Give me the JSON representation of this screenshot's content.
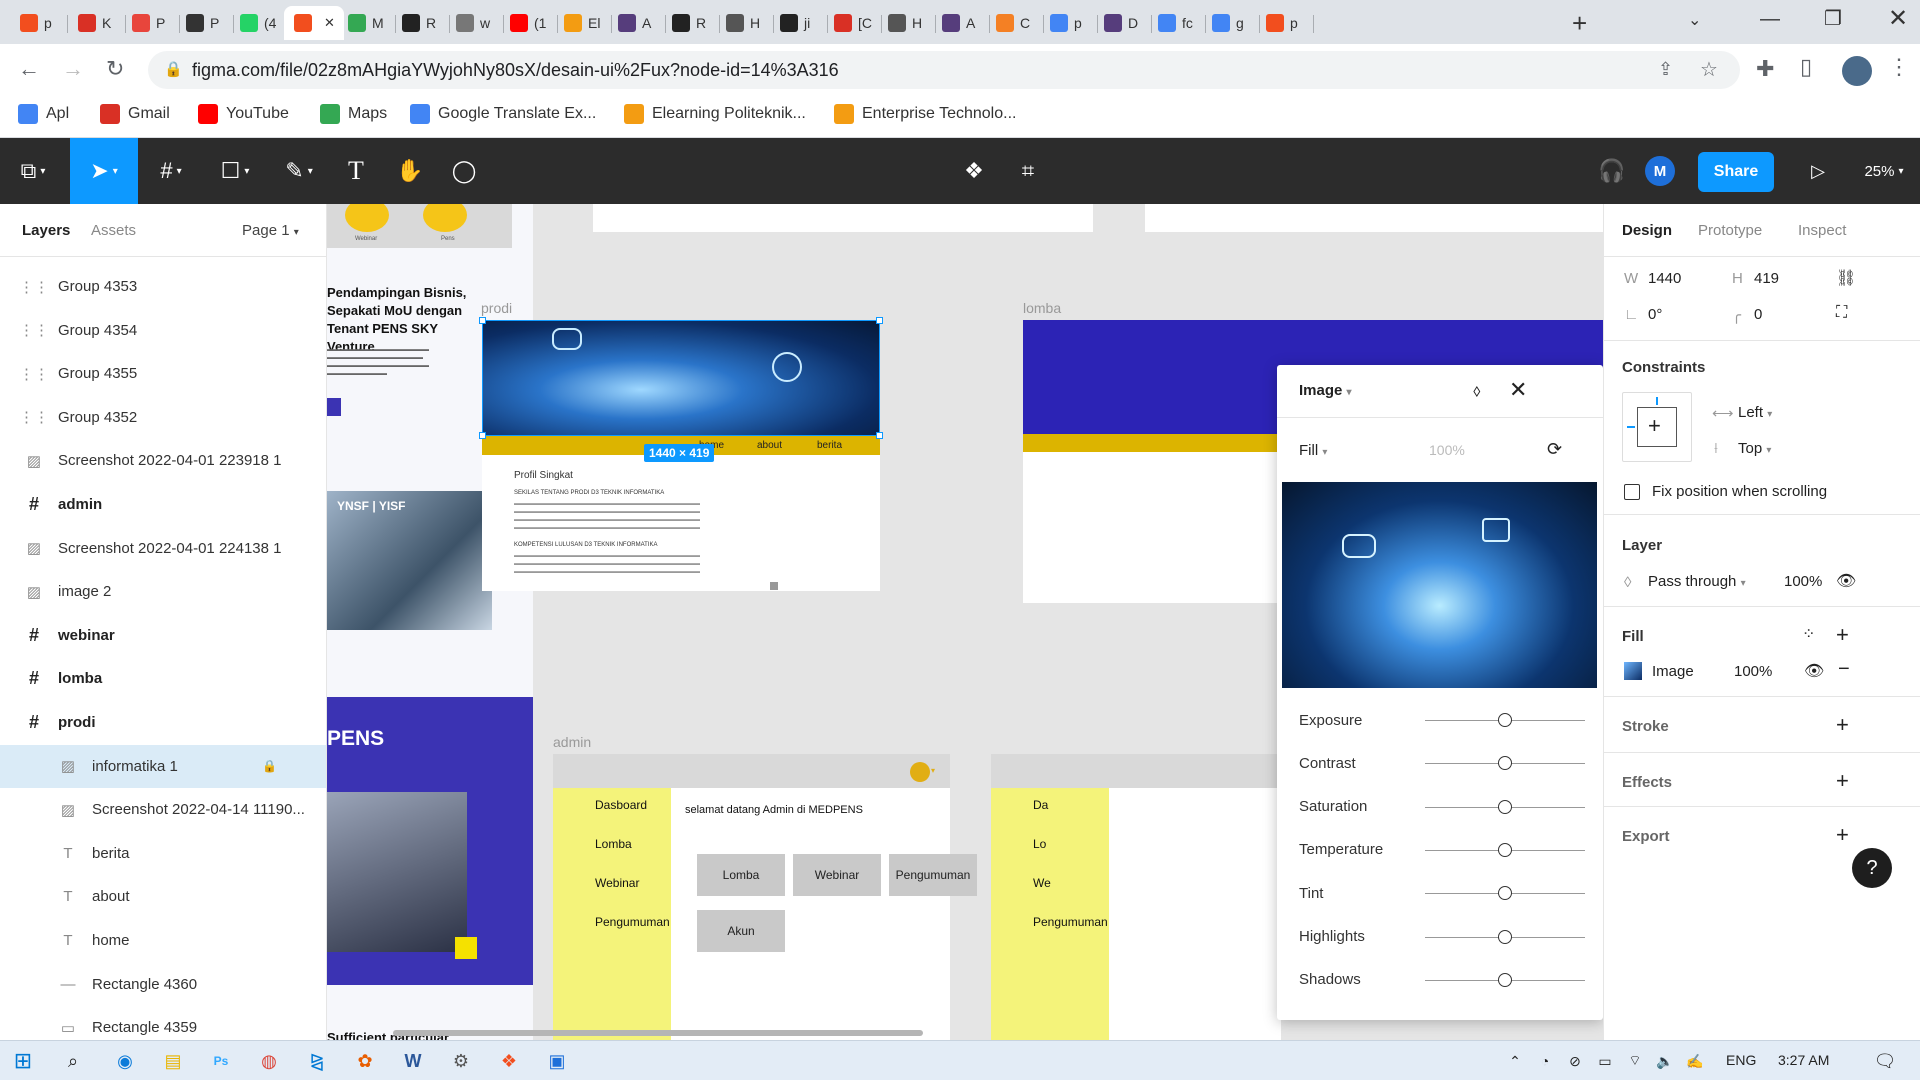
{
  "browser": {
    "tabs": [
      {
        "label": "p",
        "favicon": "figma",
        "color": "#f24e1e"
      },
      {
        "label": "K",
        "favicon": "gmail",
        "color": "#d93025"
      },
      {
        "label": "P",
        "favicon": "office-grid",
        "color": "#e8453c"
      },
      {
        "label": "P",
        "favicon": "ms",
        "color": "#333333"
      },
      {
        "label": "(4",
        "favicon": "whatsapp-49",
        "color": "#25d366"
      },
      {
        "label": "",
        "favicon": "figma",
        "color": "#f24e1e",
        "active": true
      },
      {
        "label": "M",
        "favicon": "sheets",
        "color": "#34a853"
      },
      {
        "label": "R",
        "favicon": "github",
        "color": "#222222"
      },
      {
        "label": "w",
        "favicon": "globe",
        "color": "#777777"
      },
      {
        "label": "(1",
        "favicon": "youtube",
        "color": "#ff0000"
      },
      {
        "label": "El",
        "favicon": "elearning",
        "color": "#f39c12"
      },
      {
        "label": "A",
        "favicon": "bootstrap",
        "color": "#563d7c"
      },
      {
        "label": "R",
        "favicon": "github",
        "color": "#222222"
      },
      {
        "label": "H",
        "favicon": "globe",
        "color": "#555555"
      },
      {
        "label": "ji",
        "favicon": "github",
        "color": "#222222"
      },
      {
        "label": "[C",
        "favicon": "gmail",
        "color": "#d93025"
      },
      {
        "label": "H",
        "favicon": "globe",
        "color": "#555555"
      },
      {
        "label": "A",
        "favicon": "bootstrap",
        "color": "#563d7c"
      },
      {
        "label": "C",
        "favicon": "stackoverflow",
        "color": "#f48024"
      },
      {
        "label": "p",
        "favicon": "google",
        "color": "#4285f4"
      },
      {
        "label": "D",
        "favicon": "bootstrap",
        "color": "#563d7c"
      },
      {
        "label": "fc",
        "favicon": "google",
        "color": "#4285f4"
      },
      {
        "label": "g",
        "favicon": "google",
        "color": "#4285f4"
      },
      {
        "label": "p",
        "favicon": "figma",
        "color": "#f24e1e"
      }
    ],
    "url": "figma.com/file/02z8mAHgiaYWyjohNy80sX/desain-ui%2Fux?node-id=14%3A316",
    "bookmarks": [
      {
        "label": "Apl",
        "icon": "apps-grid-icon",
        "color": "#4285f4"
      },
      {
        "label": "Gmail",
        "icon": "gmail-icon",
        "color": "#d93025"
      },
      {
        "label": "YouTube",
        "icon": "youtube-icon",
        "color": "#ff0000"
      },
      {
        "label": "Maps",
        "icon": "maps-icon",
        "color": "#34a853"
      },
      {
        "label": "Google Translate Ex...",
        "icon": "translate-icon",
        "color": "#4285f4"
      },
      {
        "label": "Elearning Politeknik...",
        "icon": "elearning-icon",
        "color": "#f39c12"
      },
      {
        "label": "Enterprise Technolo...",
        "icon": "enterprise-icon",
        "color": "#f39c12"
      }
    ]
  },
  "toolbar": {
    "share_label": "Share",
    "avatar_letter": "M",
    "zoom": "25%",
    "accent": "#0d99ff"
  },
  "left_panel": {
    "tab_layers": "Layers",
    "tab_assets": "Assets",
    "page": "Page 1",
    "layers": [
      {
        "name": "Group 4353",
        "icon": "group",
        "indent": 0
      },
      {
        "name": "Group 4354",
        "icon": "group",
        "indent": 0
      },
      {
        "name": "Group 4355",
        "icon": "group",
        "indent": 0
      },
      {
        "name": "Group 4352",
        "icon": "group",
        "indent": 0
      },
      {
        "name": "Screenshot 2022-04-01 223918 1",
        "icon": "image",
        "indent": 0
      },
      {
        "name": "admin",
        "icon": "frame",
        "indent": 0,
        "bold": true
      },
      {
        "name": "Screenshot 2022-04-01 224138 1",
        "icon": "image",
        "indent": 0
      },
      {
        "name": "image 2",
        "icon": "image",
        "indent": 0
      },
      {
        "name": "webinar",
        "icon": "frame",
        "indent": 0,
        "bold": true
      },
      {
        "name": "lomba",
        "icon": "frame",
        "indent": 0,
        "bold": true
      },
      {
        "name": "prodi",
        "icon": "frame",
        "indent": 0,
        "bold": true
      },
      {
        "name": "informatika 1",
        "icon": "image",
        "indent": 1,
        "selected": true,
        "locked": true
      },
      {
        "name": "Screenshot 2022-04-14 11190...",
        "icon": "image",
        "indent": 1
      },
      {
        "name": "berita",
        "icon": "text",
        "indent": 1
      },
      {
        "name": "about",
        "icon": "text",
        "indent": 1
      },
      {
        "name": "home",
        "icon": "text",
        "indent": 1
      },
      {
        "name": "Rectangle 4360",
        "icon": "line",
        "indent": 1
      },
      {
        "name": "Rectangle 4359",
        "icon": "rect",
        "indent": 1
      }
    ]
  },
  "canvas": {
    "frame_prodi": "prodi",
    "frame_lomba": "lomba",
    "frame_admin": "admin",
    "size_badge": "1440 × 419",
    "prodi_nav": [
      "home",
      "about",
      "berita"
    ],
    "profil_title": "Profil Singkat",
    "profil_h1": "SEKILAS TENTANG PRODI D3 TEKNIK INFORMATIKA",
    "profil_h2": "KOMPETENSI LULUSAN D3 TEKNIK INFORMATIKA",
    "side_title": "Pendampingan Bisnis, Sepakati MoU dengan Tenant PENS SKY Venture",
    "side_webinar": "Webinar",
    "side_pens": "Pens",
    "side_pens_big": "PENS",
    "side_bottom": "Sufficient particular",
    "admin_menu": [
      "Dasboard",
      "Lomba",
      "Webinar",
      "Pengumuman"
    ],
    "admin_menu_right": [
      "Da",
      "Lo",
      "We",
      "Pengumuman"
    ],
    "admin_welcome": "selamat datang Admin di MEDPENS",
    "admin_buttons": [
      "Lomba",
      "Webinar",
      "Pengumuman",
      "Akun"
    ]
  },
  "image_popup": {
    "title": "Image",
    "fill_mode": "Fill",
    "opacity": "100%",
    "sliders": [
      {
        "label": "Exposure",
        "value": 0
      },
      {
        "label": "Contrast",
        "value": 0
      },
      {
        "label": "Saturation",
        "value": 0
      },
      {
        "label": "Temperature",
        "value": 0
      },
      {
        "label": "Tint",
        "value": 0
      },
      {
        "label": "Highlights",
        "value": 0
      },
      {
        "label": "Shadows",
        "value": 0
      }
    ]
  },
  "right_panel": {
    "tabs": [
      "Design",
      "Prototype",
      "Inspect"
    ],
    "w_label": "W",
    "w_value": "1440",
    "h_label": "H",
    "h_value": "419",
    "rotation": "0°",
    "radius": "0",
    "constraints_title": "Constraints",
    "constraint_h": "Left",
    "constraint_v": "Top",
    "fix_position": "Fix position when scrolling",
    "layer_title": "Layer",
    "blend": "Pass through",
    "layer_opacity": "100%",
    "fill_title": "Fill",
    "fill_type": "Image",
    "fill_opacity": "100%",
    "stroke_title": "Stroke",
    "effects_title": "Effects",
    "export_title": "Export",
    "help": "?"
  },
  "taskbar": {
    "lang": "ENG",
    "time": "3:27 AM"
  }
}
